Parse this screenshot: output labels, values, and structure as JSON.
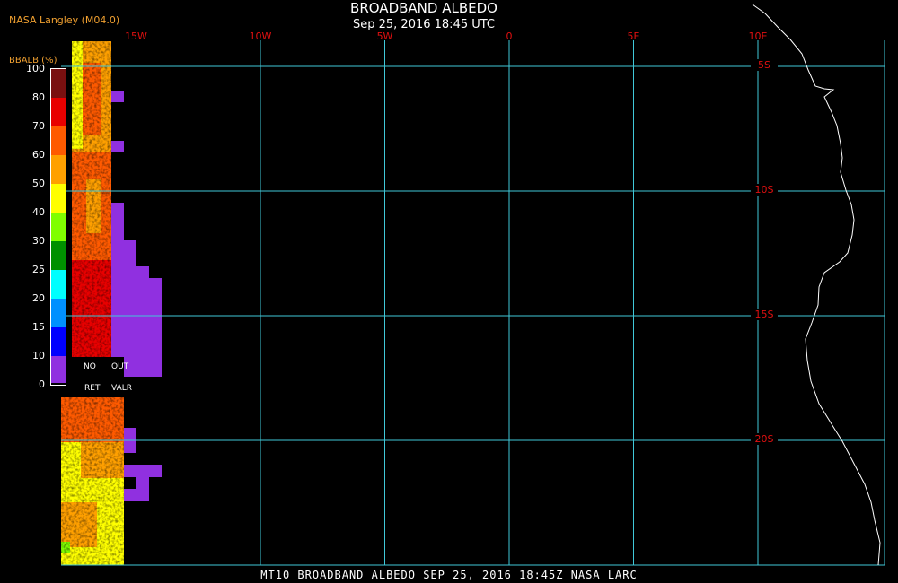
{
  "header": {
    "credit": "NASA Langley (M04.0)",
    "title": "BROADBAND ALBEDO",
    "subtitle": "Sep 25, 2016 18:45 UTC"
  },
  "footer": {
    "caption": "MT10  BROADBAND ALBEDO  SEP 25, 2016 18:45Z  NASA LARC"
  },
  "map": {
    "longitude_labels": [
      {
        "label": "15W",
        "lon": -15
      },
      {
        "label": "10W",
        "lon": -10
      },
      {
        "label": "5W",
        "lon": -5
      },
      {
        "label": "0",
        "lon": 0
      },
      {
        "label": "5E",
        "lon": 5
      },
      {
        "label": "10E",
        "lon": 10
      }
    ],
    "latitude_labels": [
      {
        "label": "5S",
        "lat": -5
      },
      {
        "label": "10S",
        "lat": -10
      },
      {
        "label": "15S",
        "lat": -15
      },
      {
        "label": "20S",
        "lat": -20
      }
    ],
    "colors": {
      "grid": "#40c8d8",
      "axis_label": "#e01010",
      "coastline": "#ffffff"
    }
  },
  "colorbar": {
    "title": "BBALB (%)",
    "ticks": [
      "100",
      "80",
      "70",
      "60",
      "50",
      "40",
      "30",
      "25",
      "20",
      "15",
      "10",
      "0"
    ],
    "bins": [
      {
        "range": "80-100",
        "color": "#7a1010"
      },
      {
        "range": "70-80",
        "color": "#e80000"
      },
      {
        "range": "60-70",
        "color": "#ff5a00"
      },
      {
        "range": "50-60",
        "color": "#ffa000"
      },
      {
        "range": "40-50",
        "color": "#ffff00"
      },
      {
        "range": "30-40",
        "color": "#80ff00"
      },
      {
        "range": "25-30",
        "color": "#009000"
      },
      {
        "range": "20-25",
        "color": "#00ffff"
      },
      {
        "range": "15-20",
        "color": "#0090ff"
      },
      {
        "range": "10-15",
        "color": "#0000ff"
      },
      {
        "range": "0-10",
        "color": "#9030e0"
      }
    ],
    "no_retrieval": [
      "NO",
      "RET"
    ],
    "out_of_range": [
      "OUT",
      "VALR"
    ],
    "no_retrieval_color": "#9030e0"
  }
}
